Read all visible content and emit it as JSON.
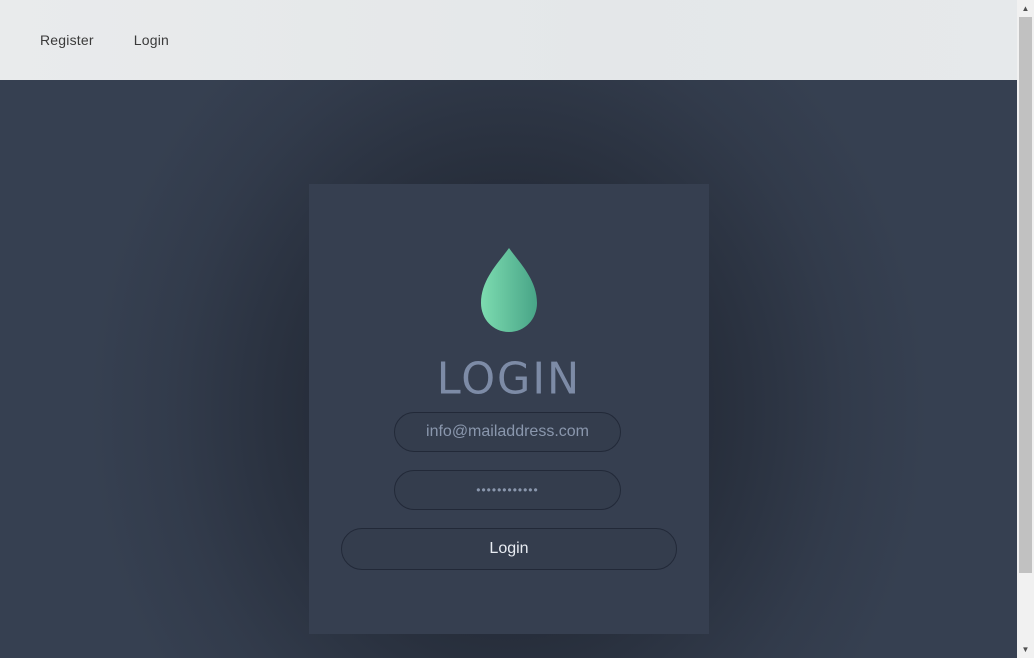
{
  "nav": {
    "register_label": "Register",
    "login_label": "Login"
  },
  "login_form": {
    "title": "LOGIN",
    "email": {
      "value": "info@mailaddress.com"
    },
    "password": {
      "value": "••••••••••••"
    },
    "submit_label": "Login"
  },
  "icons": {
    "logo": "water-drop-icon"
  },
  "colors": {
    "background": "#36404f",
    "topbar": "#e6e9eb",
    "card": "#363f50",
    "title": "#7d8ba6",
    "drop_gradient_start": "#7ddcb0",
    "drop_gradient_end": "#48a487",
    "field_border": "#222938"
  }
}
